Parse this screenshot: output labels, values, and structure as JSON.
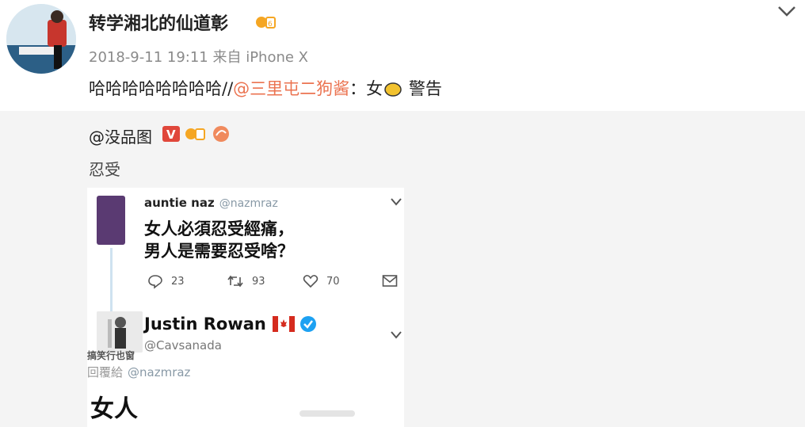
{
  "post": {
    "username": "转学湘北的仙道彰",
    "meta": "2018-9-11 19:11 来自 iPhone X",
    "text_prefix": "哈哈哈哈哈哈哈哈//",
    "mention": "@三里屯二狗酱",
    "text_suffix": "：女",
    "text_end": "警告"
  },
  "repost": {
    "user": "@没品图",
    "text": "忍受"
  },
  "tweet1": {
    "name": "auntie naz",
    "handle": "@nazmraz",
    "line1": "女人必須忍受經痛，",
    "line2": "男人是需要忍受啥？",
    "reply_count": "23",
    "retweet_count": "93",
    "like_count": "70"
  },
  "tweet2": {
    "name": "Justin Rowan",
    "handle": "@Cavsanada",
    "avatar_caption": "搞笑行也窗",
    "reply_label": "回覆給",
    "reply_handle": "@nazmraz",
    "text": "女人"
  },
  "icons": {
    "chevron": "chevron-down-icon",
    "vip": "vip-badge-icon",
    "verified": "verified-badge-icon"
  },
  "colors": {
    "mention": "#eb7350",
    "verified": "#1da1f2",
    "badge_red": "#e0473b",
    "badge_orange": "#f5a623"
  }
}
